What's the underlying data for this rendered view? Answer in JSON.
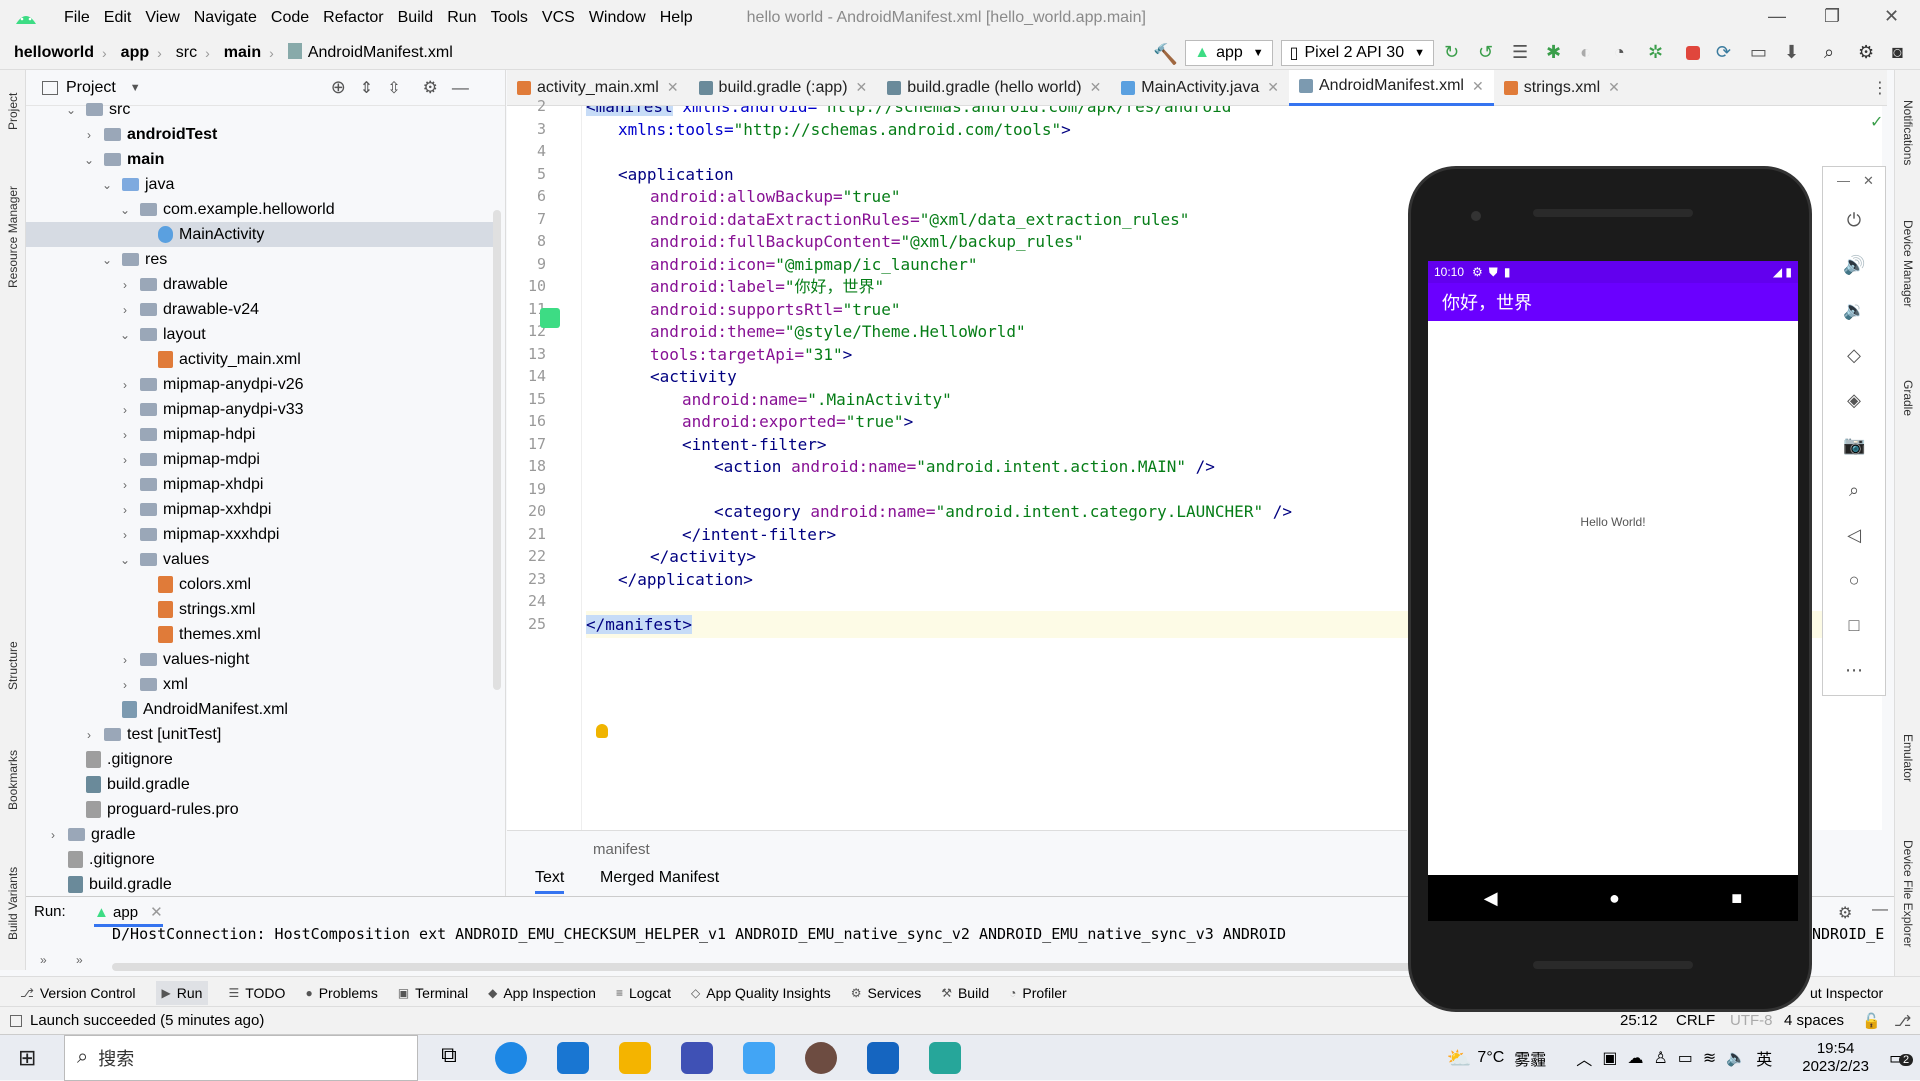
{
  "menu": {
    "items": [
      "File",
      "Edit",
      "View",
      "Navigate",
      "Code",
      "Refactor",
      "Build",
      "Run",
      "Tools",
      "VCS",
      "Window",
      "Help"
    ],
    "window_title": "hello world - AndroidManifest.xml [hello_world.app.main]"
  },
  "breadcrumb": [
    "helloworld",
    "app",
    "src",
    "main",
    "AndroidManifest.xml"
  ],
  "toolbar": {
    "run_config": "app",
    "device": "Pixel 2 API 30"
  },
  "project_panel": {
    "title": "Project",
    "tree": [
      {
        "label": "src",
        "indent": 0,
        "arrow": "open"
      },
      {
        "label": "androidTest",
        "indent": 1,
        "arrow": "closed",
        "bold": true
      },
      {
        "label": "main",
        "indent": 1,
        "arrow": "open",
        "bold": true
      },
      {
        "label": "java",
        "indent": 2,
        "arrow": "open",
        "blue": true
      },
      {
        "label": "com.example.helloworld",
        "indent": 3,
        "arrow": "open"
      },
      {
        "label": "MainActivity",
        "indent": 4,
        "type": "class",
        "selected": true
      },
      {
        "label": "res",
        "indent": 2,
        "arrow": "open"
      },
      {
        "label": "drawable",
        "indent": 3,
        "arrow": "closed"
      },
      {
        "label": "drawable-v24",
        "indent": 3,
        "arrow": "closed"
      },
      {
        "label": "layout",
        "indent": 3,
        "arrow": "open"
      },
      {
        "label": "activity_main.xml",
        "indent": 4,
        "type": "xml"
      },
      {
        "label": "mipmap-anydpi-v26",
        "indent": 3,
        "arrow": "closed"
      },
      {
        "label": "mipmap-anydpi-v33",
        "indent": 3,
        "arrow": "closed"
      },
      {
        "label": "mipmap-hdpi",
        "indent": 3,
        "arrow": "closed"
      },
      {
        "label": "mipmap-mdpi",
        "indent": 3,
        "arrow": "closed"
      },
      {
        "label": "mipmap-xhdpi",
        "indent": 3,
        "arrow": "closed"
      },
      {
        "label": "mipmap-xxhdpi",
        "indent": 3,
        "arrow": "closed"
      },
      {
        "label": "mipmap-xxxhdpi",
        "indent": 3,
        "arrow": "closed"
      },
      {
        "label": "values",
        "indent": 3,
        "arrow": "open"
      },
      {
        "label": "colors.xml",
        "indent": 4,
        "type": "xml"
      },
      {
        "label": "strings.xml",
        "indent": 4,
        "type": "xml"
      },
      {
        "label": "themes.xml",
        "indent": 4,
        "type": "xml"
      },
      {
        "label": "values-night",
        "indent": 3,
        "arrow": "closed"
      },
      {
        "label": "xml",
        "indent": 3,
        "arrow": "closed"
      },
      {
        "label": "AndroidManifest.xml",
        "indent": 2,
        "type": "manifest"
      },
      {
        "label": "test [unitTest]",
        "indent": 1,
        "arrow": "closed"
      },
      {
        "label": ".gitignore",
        "indent": 0,
        "type": "file"
      },
      {
        "label": "build.gradle",
        "indent": 0,
        "type": "gradle"
      },
      {
        "label": "proguard-rules.pro",
        "indent": 0,
        "type": "file"
      },
      {
        "label": "gradle",
        "indent": -1,
        "arrow": "closed"
      },
      {
        "label": ".gitignore",
        "indent": -1,
        "type": "file"
      },
      {
        "label": "build.gradle",
        "indent": -1,
        "type": "gradle"
      }
    ]
  },
  "editor_tabs": [
    {
      "label": "activity_main.xml",
      "active": false
    },
    {
      "label": "build.gradle (:app)",
      "active": false
    },
    {
      "label": "build.gradle (hello world)",
      "active": false
    },
    {
      "label": "MainActivity.java",
      "active": false
    },
    {
      "label": "AndroidManifest.xml",
      "active": true
    },
    {
      "label": "strings.xml",
      "active": false
    }
  ],
  "code_lines": [
    {
      "n": 2,
      "indent": 0,
      "parts": [
        [
          "hl-tag",
          "<manifest"
        ],
        [
          "t-attr",
          " xmlns:android="
        ],
        [
          "t-str",
          "\"http://schemas.android.com/apk/res/android\""
        ]
      ]
    },
    {
      "n": 3,
      "indent": 1,
      "parts": [
        [
          "t-attr",
          "xmlns:tools="
        ],
        [
          "t-str",
          "\"http://schemas.android.com/tools\""
        ],
        [
          "t-tag",
          ">"
        ]
      ]
    },
    {
      "n": 4,
      "indent": 0,
      "parts": []
    },
    {
      "n": 5,
      "indent": 1,
      "parts": [
        [
          "t-tag",
          "<application"
        ]
      ]
    },
    {
      "n": 6,
      "indent": 2,
      "parts": [
        [
          "t-attr2",
          "android:allowBackup="
        ],
        [
          "t-str",
          "\"true\""
        ]
      ]
    },
    {
      "n": 7,
      "indent": 2,
      "parts": [
        [
          "t-attr2",
          "android:dataExtractionRules="
        ],
        [
          "t-str",
          "\"@xml/data_extraction_rules\""
        ]
      ]
    },
    {
      "n": 8,
      "indent": 2,
      "parts": [
        [
          "t-attr2",
          "android:fullBackupContent="
        ],
        [
          "t-str",
          "\"@xml/backup_rules\""
        ]
      ]
    },
    {
      "n": 9,
      "indent": 2,
      "parts": [
        [
          "t-attr2",
          "android:icon="
        ],
        [
          "t-str",
          "\"@mipmap/ic_launcher\""
        ]
      ]
    },
    {
      "n": 10,
      "indent": 2,
      "parts": [
        [
          "t-attr2",
          "android:label="
        ],
        [
          "t-str",
          "\"你好，世界\""
        ]
      ]
    },
    {
      "n": 11,
      "indent": 2,
      "parts": [
        [
          "t-attr2",
          "android:supportsRtl="
        ],
        [
          "t-str",
          "\"true\""
        ]
      ]
    },
    {
      "n": 12,
      "indent": 2,
      "parts": [
        [
          "t-attr2",
          "android:theme="
        ],
        [
          "t-str",
          "\"@style/Theme.HelloWorld\""
        ]
      ]
    },
    {
      "n": 13,
      "indent": 2,
      "parts": [
        [
          "t-attr2",
          "tools:targetApi="
        ],
        [
          "t-str",
          "\"31\""
        ],
        [
          "t-tag",
          ">"
        ]
      ]
    },
    {
      "n": 14,
      "indent": 2,
      "parts": [
        [
          "t-tag",
          "<activity"
        ]
      ]
    },
    {
      "n": 15,
      "indent": 3,
      "parts": [
        [
          "t-attr2",
          "android:name="
        ],
        [
          "t-str",
          "\".MainActivity\""
        ]
      ]
    },
    {
      "n": 16,
      "indent": 3,
      "parts": [
        [
          "t-attr2",
          "android:exported="
        ],
        [
          "t-str",
          "\"true\""
        ],
        [
          "t-tag",
          ">"
        ]
      ]
    },
    {
      "n": 17,
      "indent": 3,
      "parts": [
        [
          "t-tag",
          "<intent-filter>"
        ]
      ]
    },
    {
      "n": 18,
      "indent": 4,
      "parts": [
        [
          "t-tag",
          "<action "
        ],
        [
          "t-attr2",
          "android:name="
        ],
        [
          "t-str",
          "\"android.intent.action.MAIN\""
        ],
        [
          "t-tag",
          " />"
        ]
      ]
    },
    {
      "n": 19,
      "indent": 0,
      "parts": []
    },
    {
      "n": 20,
      "indent": 4,
      "parts": [
        [
          "t-tag",
          "<category "
        ],
        [
          "t-attr2",
          "android:name="
        ],
        [
          "t-str",
          "\"android.intent.category.LAUNCHER\""
        ],
        [
          "t-tag",
          " />"
        ]
      ]
    },
    {
      "n": 21,
      "indent": 3,
      "parts": [
        [
          "t-tag",
          "</intent-filter>"
        ]
      ]
    },
    {
      "n": 22,
      "indent": 2,
      "parts": [
        [
          "t-tag",
          "</activity>"
        ]
      ]
    },
    {
      "n": 23,
      "indent": 1,
      "parts": [
        [
          "t-tag",
          "</application>"
        ]
      ]
    },
    {
      "n": 24,
      "indent": 0,
      "parts": []
    },
    {
      "n": 25,
      "indent": 0,
      "parts": [
        [
          "hl-tag",
          "</manifest>"
        ]
      ]
    }
  ],
  "editor_bottom": {
    "breadcrumb": "manifest",
    "tab_text": "Text",
    "tab_merged": "Merged Manifest"
  },
  "run_panel": {
    "label": "Run:",
    "config": "app",
    "log_line": "D/HostConnection: HostComposition ext ANDROID_EMU_CHECKSUM_HELPER_v1 ANDROID_EMU_native_sync_v2 ANDROID_EMU_native_sync_v3 ANDROID",
    "log_tail": "NDROID_E"
  },
  "bottom_tools": [
    "Version Control",
    "Run",
    "TODO",
    "Problems",
    "Terminal",
    "App Inspection",
    "Logcat",
    "App Quality Insights",
    "Services",
    "Build",
    "Profiler"
  ],
  "bottom_tools_right": "ut Inspector",
  "status": {
    "message": "Launch succeeded (5 minutes ago)",
    "position": "25:12",
    "line_sep": "CRLF",
    "encoding": "UTF-8",
    "indent": "4 spaces"
  },
  "left_strip": [
    "Project",
    "Resource Manager",
    "Structure",
    "Bookmarks",
    "Build Variants"
  ],
  "right_strip": [
    "Notifications",
    "Device Manager",
    "Gradle",
    "Emulator",
    "Device File Explorer"
  ],
  "phone": {
    "time": "10:10",
    "app_title": "你好，世界",
    "text": "Hello World!"
  },
  "taskbar": {
    "search_placeholder": "搜索",
    "weather": "7°C",
    "weather_desc": "雾霾",
    "ime": "英",
    "time": "19:54",
    "date": "2023/2/23",
    "notifications": "2"
  },
  "colors": {
    "accent": "#3574f0",
    "phone_bar": "#6200ee"
  }
}
